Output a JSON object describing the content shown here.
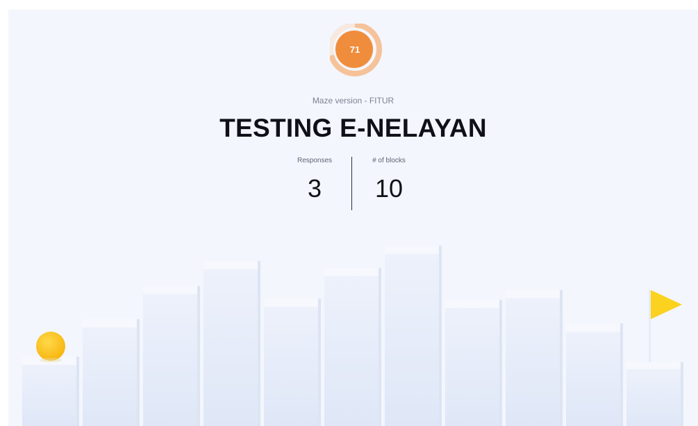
{
  "score": {
    "value": "71",
    "fraction": 0.71,
    "color": "#f08d3c",
    "ring_color": "#f6c8a1"
  },
  "header": {
    "subtitle": "Maze version - FITUR",
    "title": "TESTING E-NELAYAN"
  },
  "stats": {
    "responses": {
      "label": "Responses",
      "value": "3"
    },
    "blocks": {
      "label": "# of blocks",
      "value": "10"
    }
  },
  "scene": {
    "ball_color": "#fbc518",
    "flag_color": "#fbd21f",
    "flag_icon": "triangle-flag-icon",
    "ball_icon": "circle-ball-icon"
  }
}
